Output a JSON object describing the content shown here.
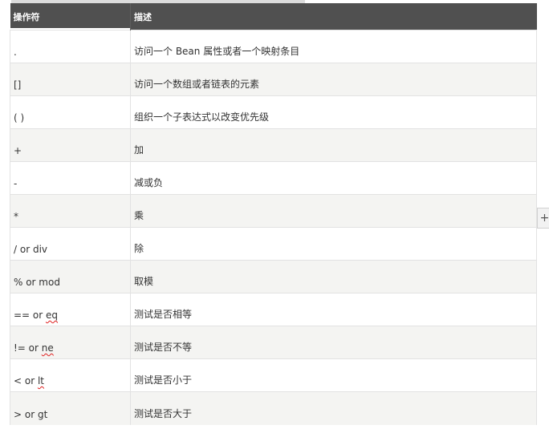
{
  "table": {
    "headers": {
      "operator": "操作符",
      "description": "描述"
    },
    "rows": [
      {
        "operator": ".",
        "description": "访问一个 Bean 属性或者一个映射条目"
      },
      {
        "operator": "[]",
        "description": "访问一个数组或者链表的元素"
      },
      {
        "operator": "( )",
        "description": "组织一个子表达式以改变优先级"
      },
      {
        "operator": "+",
        "description": "加"
      },
      {
        "operator": "-",
        "description": "减或负"
      },
      {
        "operator": "*",
        "description": "乘"
      },
      {
        "operator": "/ or div",
        "description": "除"
      },
      {
        "operator": "% or mod",
        "description": "取模"
      },
      {
        "operator_prefix": "== or ",
        "operator_word": "eq",
        "description": "测试是否相等"
      },
      {
        "operator_prefix": "!= or ",
        "operator_word": "ne",
        "description": "测试是否不等"
      },
      {
        "operator_prefix": "< or ",
        "operator_word": "lt",
        "description": "测试是否小于"
      },
      {
        "operator": "> or gt",
        "description": "测试是否大于"
      }
    ]
  },
  "side_handle": {
    "icon": "plus-icon",
    "glyph": "+"
  }
}
